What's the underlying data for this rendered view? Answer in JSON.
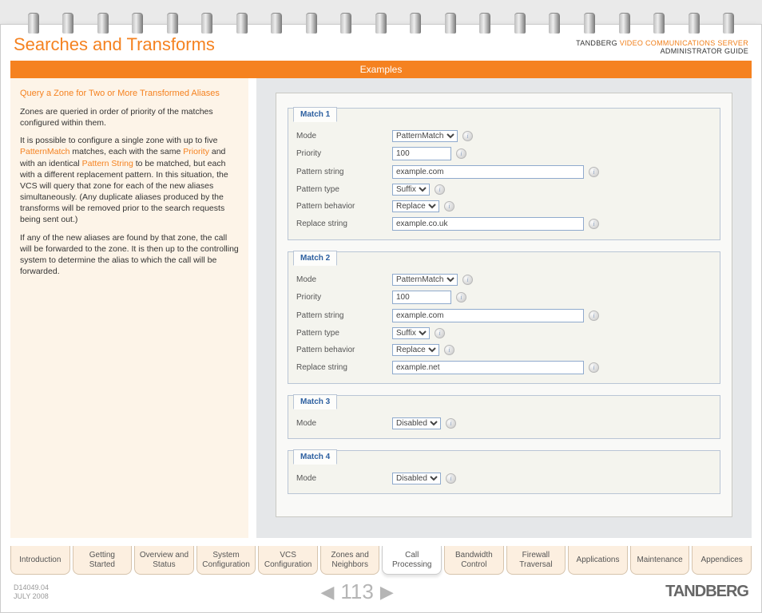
{
  "header": {
    "title": "Searches and Transforms",
    "brand_prefix": "TANDBERG ",
    "brand_product": "VIDEO COMMUNICATIONS SERVER",
    "brand_sub": "ADMINISTRATOR GUIDE",
    "bar_label": "Examples"
  },
  "left": {
    "heading": "Query a Zone for Two or More Transformed Aliases",
    "p1": "Zones are queried in order of priority of the matches configured within them.",
    "p2a": "It is possible to configure a single zone with up to five ",
    "p2_l1": "PatternMatch",
    "p2b": " matches, each with the same ",
    "p2_l2": "Priority",
    "p2c": " and with an identical ",
    "p2_l3": "Pattern String",
    "p2d": " to be matched, but each with a different replacement pattern.  In this situation, the VCS will query that zone for each of the new aliases simultaneously. (Any duplicate aliases produced by the transforms will be removed prior to the search requests being sent out.)",
    "p3": "If any of the new aliases are found by that zone, the call will be forwarded to the zone.  It is then up to the controlling system to determine the alias to which the call will be forwarded."
  },
  "labels": {
    "mode": "Mode",
    "priority": "Priority",
    "pstring": "Pattern string",
    "ptype": "Pattern type",
    "pbehav": "Pattern behavior",
    "rstring": "Replace string"
  },
  "matches": [
    {
      "title": "Match 1",
      "mode": "PatternMatch",
      "priority": "100",
      "pattern_string": "example.com",
      "pattern_type": "Suffix",
      "pattern_behavior": "Replace",
      "replace_string": "example.co.uk",
      "full": true
    },
    {
      "title": "Match 2",
      "mode": "PatternMatch",
      "priority": "100",
      "pattern_string": "example.com",
      "pattern_type": "Suffix",
      "pattern_behavior": "Replace",
      "replace_string": "example.net",
      "full": true
    },
    {
      "title": "Match 3",
      "mode": "Disabled",
      "full": false
    },
    {
      "title": "Match 4",
      "mode": "Disabled",
      "full": false
    }
  ],
  "nav": {
    "items": [
      "Introduction",
      "Getting Started",
      "Overview and Status",
      "System Configuration",
      "VCS Configuration",
      "Zones and Neighbors",
      "Call Processing",
      "Bandwidth Control",
      "Firewall Traversal",
      "Applications",
      "Maintenance",
      "Appendices"
    ],
    "active_index": 6
  },
  "footer": {
    "doc_id": "D14049.04",
    "date": "JULY 2008",
    "page": "113",
    "brand": "TANDBERG"
  }
}
